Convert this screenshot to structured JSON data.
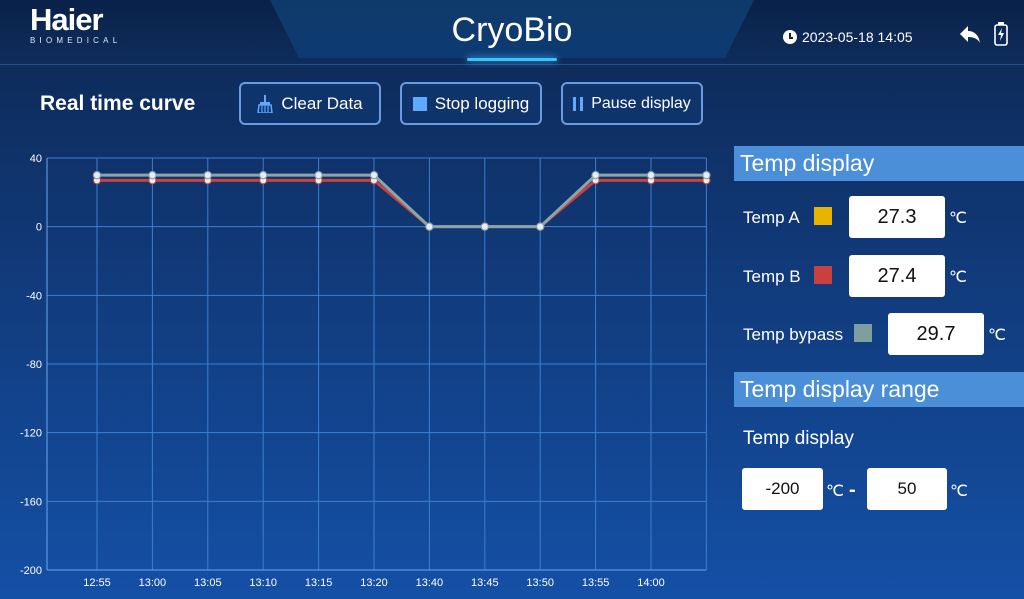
{
  "header": {
    "logo_name": "Haier",
    "logo_sub": "BIOMEDICAL",
    "title": "CryoBio",
    "datetime": "2023-05-18 14:05"
  },
  "toolbar": {
    "title": "Real time curve",
    "clear_label": "Clear Data",
    "stop_label": "Stop logging",
    "pause_label": "Pause display"
  },
  "temp_display": {
    "heading": "Temp display",
    "a_label": "Temp A",
    "a_value": "27.3",
    "a_unit": "℃",
    "a_color": "#e8b400",
    "b_label": "Temp B",
    "b_value": "27.4",
    "b_unit": "℃",
    "b_color": "#c9413f",
    "bypass_label": "Temp bypass",
    "bypass_value": "29.7",
    "bypass_unit": "℃",
    "bypass_color": "#7d9fa0"
  },
  "range": {
    "heading": "Temp display range",
    "label": "Temp display",
    "min": "-200",
    "min_unit": "℃",
    "separator": "-",
    "max": "50",
    "max_unit": "℃"
  },
  "chart_data": {
    "type": "line",
    "x": [
      "12:55",
      "13:00",
      "13:05",
      "13:10",
      "13:15",
      "13:20",
      "13:40",
      "13:45",
      "13:50",
      "13:55",
      "14:00",
      ""
    ],
    "series": [
      {
        "color": "#c9413f",
        "values": [
          27,
          27,
          27,
          27,
          27,
          27,
          0,
          0,
          0,
          27,
          27,
          27
        ]
      },
      {
        "color": "#8aa6a8",
        "values": [
          30,
          30,
          30,
          30,
          30,
          30,
          0,
          0,
          0,
          30,
          30,
          30
        ]
      }
    ],
    "yticks": [
      40,
      0,
      -40,
      -80,
      -120,
      -160,
      -200
    ],
    "ylim": [
      -200,
      40
    ],
    "grid": true
  }
}
